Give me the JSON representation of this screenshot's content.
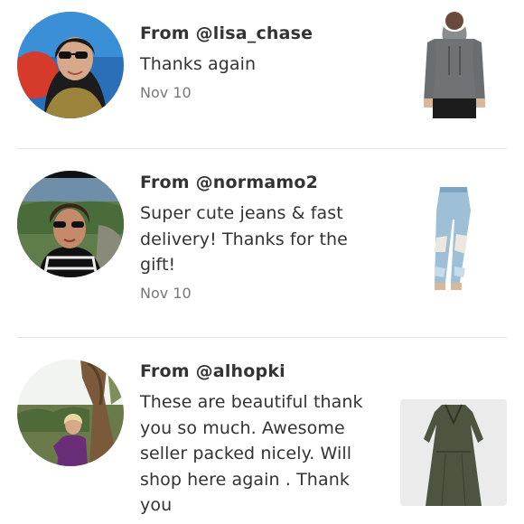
{
  "reviews": [
    {
      "from": "From @lisa_chase",
      "comment": "Thanks again",
      "date": "Nov 10",
      "avatar_icon": "profile-photo",
      "item_icon": "gray-turtleneck-sweater"
    },
    {
      "from": "From @normamo2",
      "comment": "Super cute jeans & fast delivery! Thanks for the gift!",
      "date": "Nov 10",
      "avatar_icon": "profile-photo",
      "item_icon": "distressed-jeans"
    },
    {
      "from": "From @alhopki",
      "comment": "These are beautiful thank you so much. Awesome seller packed nicely. Will shop here again . Thank you",
      "date": "",
      "avatar_icon": "profile-photo",
      "item_icon": "olive-dress"
    }
  ],
  "colors": {
    "text": "#333333",
    "muted": "#787878",
    "divider": "#e5e5e5"
  }
}
